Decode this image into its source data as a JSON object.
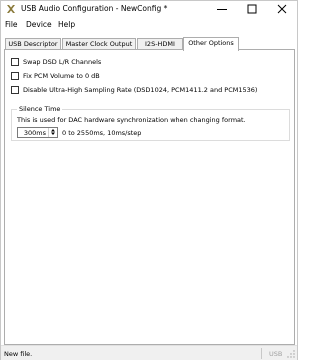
{
  "window": {
    "title": "USB Audio Configuration - NewConfig *",
    "controls": {
      "minimize": "minimize",
      "maximize": "maximize",
      "close": "close"
    }
  },
  "menu": [
    "File",
    "Device",
    "Help"
  ],
  "tabs": [
    {
      "label": "USB Descriptor",
      "active": false
    },
    {
      "label": "Master Clock Output",
      "active": false
    },
    {
      "label": "I2S-HDMI",
      "active": false
    },
    {
      "label": "Other Options",
      "active": true
    }
  ],
  "options": [
    {
      "label": "Swap DSD L/R Channels",
      "checked": false
    },
    {
      "label": "Fix PCM Volume to 0 dB",
      "checked": false
    },
    {
      "label": "Disable Ultra-High Sampling Rate (DSD1024, PCM1411.2 and PCM1536)",
      "checked": false
    }
  ],
  "silence_time": {
    "legend": "Silence Time",
    "description": "This is used for DAC hardware synchronization when changing format.",
    "value": "300ms",
    "hint": "0 to 2550ms, 10ms/step"
  },
  "status": {
    "left": "New file.",
    "right": "USB"
  },
  "icons": {
    "app": "app-logo-icon",
    "spin_up": "chevron-up-icon",
    "spin_down": "chevron-down-icon",
    "grip": "resize-grip-icon"
  },
  "colors": {
    "border": "#adadad",
    "tab_inactive": "#f0f0f0",
    "status_bg": "#f0f0f0",
    "logo": "#8a7a3a"
  }
}
